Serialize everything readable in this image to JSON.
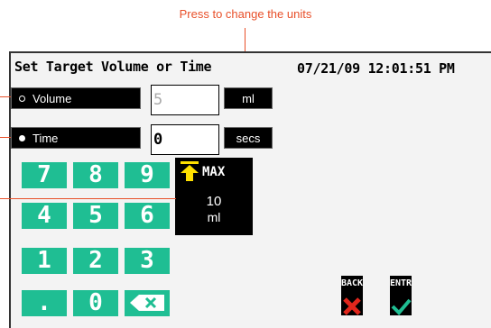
{
  "callout": "Press to change the units",
  "header": {
    "title": "Set Target Volume or Time",
    "datetime": "07/21/09 12:01:51 PM"
  },
  "volume": {
    "label": "Volume",
    "value": "5",
    "unit": "ml",
    "selected": false
  },
  "time": {
    "label": "Time",
    "value": "0",
    "unit": "secs",
    "selected": true
  },
  "keypad": [
    "7",
    "8",
    "9",
    "4",
    "5",
    "6",
    "1",
    "2",
    "3",
    ".",
    "0"
  ],
  "max": {
    "label": "MAX",
    "value": "10",
    "unit": "ml"
  },
  "back_label": "BACK",
  "enter_label": "ENTR",
  "colors": {
    "accent": "#1fbe93",
    "callout": "#e8502a",
    "cancel": "#e1261c"
  }
}
